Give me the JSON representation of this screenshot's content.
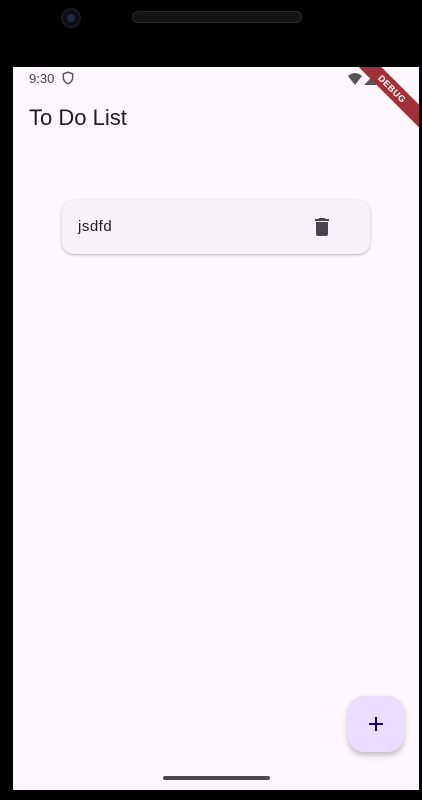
{
  "status_bar": {
    "time": "9:30",
    "icons": [
      "shield-icon",
      "wifi-icon",
      "signal-icon"
    ]
  },
  "debug_banner": {
    "label": "DEBUG"
  },
  "app_bar": {
    "title": "To Do List"
  },
  "todos": [
    {
      "text": "jsdfd",
      "action_icon": "delete-icon"
    }
  ],
  "fab": {
    "icon": "add-icon"
  },
  "colors": {
    "background": "#fdf7fe",
    "card": "#f7f2fa",
    "fab": "#eaddff",
    "text": "#1d1b20",
    "debug_banner": "#a0303a"
  }
}
